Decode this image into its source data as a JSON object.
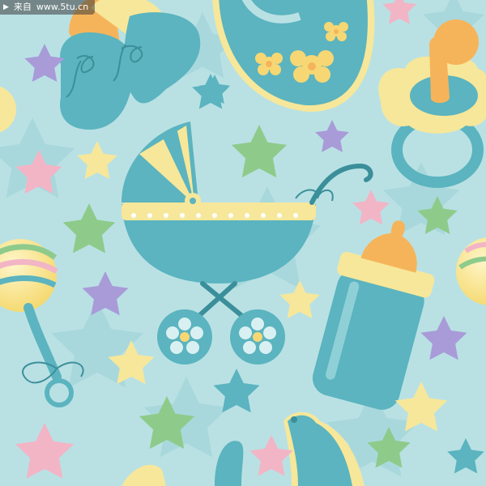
{
  "watermark": {
    "label": "来自",
    "url": "www.5tu.cn"
  },
  "colors": {
    "background": "#b9e1e4",
    "background_stars": "#a9d8dc",
    "teal": "#5bb4bf",
    "teal_dark": "#3b8f9a",
    "cream": "#f7e79a",
    "yellow": "#f7d774",
    "orange": "#f6b45a",
    "pink": "#f2b5c6",
    "purple": "#a89bd8",
    "green": "#8ecb8b",
    "white": "#ffffff"
  },
  "illustration": {
    "subjects": [
      "pram-icon",
      "baby-bottle-icon",
      "pacifier-icon",
      "bib-icon",
      "booties-icon",
      "rattle-icon",
      "toy-duck-icon",
      "star-icon"
    ]
  }
}
